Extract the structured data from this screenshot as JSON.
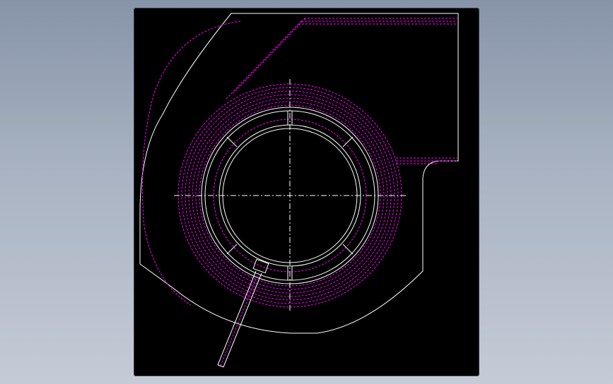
{
  "drawing": {
    "description_colors": {
      "background": "#000000",
      "outline": "#ffffff",
      "hidden": "#ff00ff",
      "window": "#8a96a8"
    }
  }
}
